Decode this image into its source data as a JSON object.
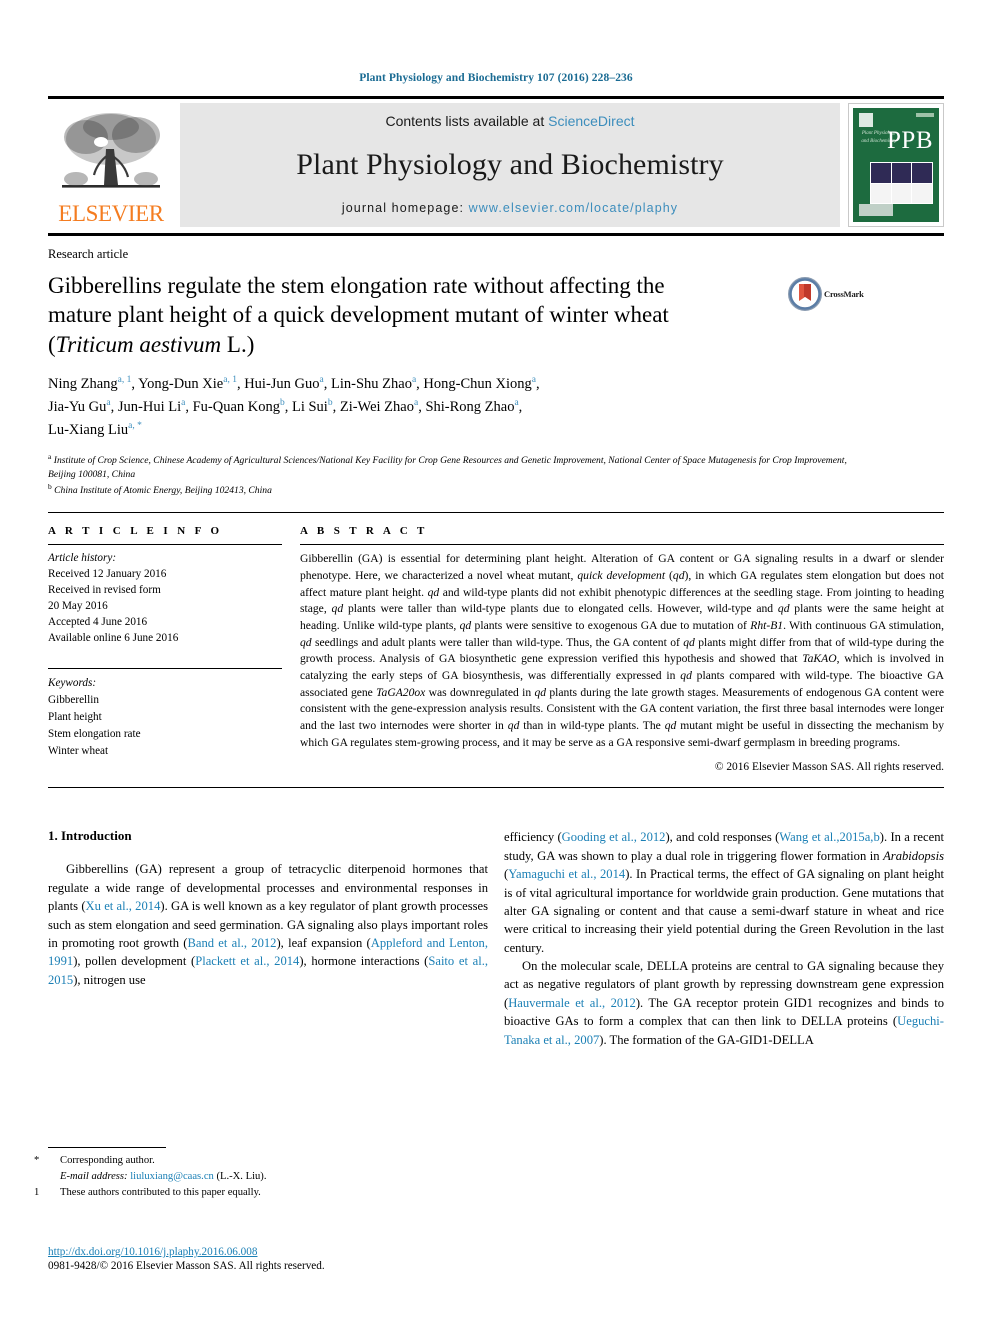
{
  "running_head": "Plant Physiology and Biochemistry 107 (2016) 228–236",
  "masthead": {
    "contents_prefix": "Contents lists available at ",
    "sciencedirect": "ScienceDirect",
    "journal_title": "Plant Physiology and Biochemistry",
    "homepage_label": "journal homepage:",
    "homepage_url": "www.elsevier.com/locate/plaphy",
    "publisher": "ELSEVIER",
    "cover_acronym": "PPB",
    "cover_journal_name": "Plant Physiology and Biochemistry",
    "link_color": "#3c8dbc",
    "cover_color": "#1d6b3f",
    "publisher_color": "#F47C20"
  },
  "article": {
    "category": "Research article",
    "title_line1": "Gibberellins regulate the stem elongation rate without affecting the",
    "title_line2": "mature plant height of a quick development mutant of winter wheat",
    "title_line3_prefix": "(",
    "title_line3_italic": "Triticum aestivum",
    "title_line3_suffix": " L.)",
    "crossmark_label": "CrossMark",
    "authors_line1": "Ning Zhang a, 1, Yong-Dun Xie a, 1, Hui-Jun Guo a, Lin-Shu Zhao a, Hong-Chun Xiong a,",
    "authors_line2": "Jia-Yu Gu a, Jun-Hui Li a, Fu-Quan Kong b, Li Sui b, Zi-Wei Zhao a, Shi-Rong Zhao a,",
    "authors_line3": "Lu-Xiang Liu a, *",
    "affiliation_a": "Institute of Crop Science, Chinese Academy of Agricultural Sciences/National Key Facility for Crop Gene Resources and Genetic Improvement, National Center of Space Mutagenesis for Crop Improvement, Beijing 100081, China",
    "affiliation_b": "China Institute of Atomic Energy, Beijing 102413, China"
  },
  "article_info": {
    "heading": "A R T I C L E  I N F O",
    "history_label": "Article history:",
    "received": "Received 12 January 2016",
    "revised_label": "Received in revised form",
    "revised_date": "20 May 2016",
    "accepted": "Accepted 4 June 2016",
    "available": "Available online 6 June 2016",
    "keywords_label": "Keywords:",
    "keywords": [
      "Gibberellin",
      "Plant height",
      "Stem elongation rate",
      "Winter wheat"
    ]
  },
  "abstract": {
    "heading": "A B S T R A C T",
    "body_part1": "Gibberellin (GA) is essential for determining plant height. Alteration of GA content or GA signaling results in a dwarf or slender phenotype. Here, we characterized a novel wheat mutant, ",
    "mutant_name_italic": "quick development",
    "body_part2": " (",
    "qd_1": "qd",
    "body_part3": "), in which GA regulates stem elongation but does not affect mature plant height. ",
    "qd_2": "qd",
    "body_part4": " and wild-type plants did not exhibit phenotypic differences at the seedling stage. From jointing to heading stage, ",
    "qd_3": "qd",
    "body_part5": " plants were taller than wild-type plants due to elongated cells. However, wild-type and ",
    "qd_4": "qd",
    "body_part6": " plants were the same height at heading. Unlike wild-type plants, ",
    "qd_5": "qd",
    "body_part7": " plants were sensitive to exogenous GA due to mutation of ",
    "rht_italic": "Rht-B1",
    "body_part8": ". With continuous GA stimulation, ",
    "qd_6": "qd",
    "body_part9": " seedlings and adult plants were taller than wild-type. Thus, the GA content of ",
    "qd_7": "qd",
    "body_part10": " plants might differ from that of wild-type during the growth process. Analysis of GA biosynthetic gene expression verified this hypothesis and showed that ",
    "takao_italic": "TaKAO",
    "body_part11": ", which is involved in catalyzing the early steps of GA biosynthesis, was differentially expressed in ",
    "qd_8": "qd",
    "body_part12": " plants compared with wild-type. The bioactive GA associated gene ",
    "taga20ox_italic": "TaGA20ox",
    "body_part13": " was downregulated in ",
    "qd_9": "qd",
    "body_part14": " plants during the late growth stages. Measurements of endogenous GA content were consistent with the gene-expression analysis results. Consistent with the GA content variation, the first three basal internodes were longer and the last two internodes were shorter in ",
    "qd_10": "qd",
    "body_part15": " than in wild-type plants. The ",
    "qd_11": "qd",
    "body_part16": " mutant might be useful in dissecting the mechanism by which GA regulates stem-growing process, and it may be serve as a GA responsive semi-dwarf germplasm in breeding programs.",
    "copyright": "© 2016 Elsevier Masson SAS. All rights reserved."
  },
  "introduction": {
    "section_number": "1.",
    "section_title": "Introduction",
    "left_p1_a": "Gibberellins (GA) represent a group of tetracyclic diterpenoid hormones that regulate a wide range of developmental processes and environmental responses in plants (",
    "ref_xu": "Xu et al., 2014",
    "left_p1_b": "). GA is well known as a key regulator of plant growth processes such as stem elongation and seed germination. GA signaling also plays important roles in promoting root growth (",
    "ref_band": "Band et al., 2012",
    "left_p1_c": "), leaf expansion (",
    "ref_appleford": "Appleford and Lenton, 1991",
    "left_p1_d": "), pollen development (",
    "ref_plackett": "Plackett et al., 2014",
    "left_p1_e": "), hormone interactions (",
    "ref_saito": "Saito et al., 2015",
    "left_p1_f": "), nitrogen use ",
    "right_p1_a": "efficiency (",
    "ref_gooding": "Gooding et al., 2012",
    "right_p1_b": "), and cold responses (",
    "ref_wang": "Wang et al.,2015a,b",
    "right_p1_c": "). In a recent study, GA was shown to play a dual role in triggering flower formation in ",
    "arabidopsis_italic": "Arabidopsis",
    "right_p1_d": " (",
    "ref_yamaguchi": "Yamaguchi et al., 2014",
    "right_p1_e": "). In Practical terms, the effect of GA signaling on plant height is of vital agricultural importance for worldwide grain production. Gene mutations that alter GA signaling or content and that cause a semi-dwarf stature in wheat and rice were critical to increasing their yield potential during the Green Revolution in the last century.",
    "right_p2_a": "On the molecular scale, DELLA proteins are central to GA signaling because they act as negative regulators of plant growth by repressing downstream gene expression (",
    "ref_hauvermale": "Hauvermale et al., 2012",
    "right_p2_b": "). The GA receptor protein GID1 recognizes and binds to bioactive GAs to form a complex that can then link to DELLA proteins (",
    "ref_ueguchi": "Ueguchi-Tanaka et al., 2007",
    "right_p2_c": "). The formation of the GA-GID1-DELLA"
  },
  "footnotes": {
    "corresponding_mark": "*",
    "corresponding_text": "Corresponding author.",
    "email_label": "E-mail address:",
    "email": "liuluxiang@caas.cn",
    "email_suffix": " (L.-X. Liu).",
    "equal_mark": "1",
    "equal_text": "These authors contributed to this paper equally.",
    "doi": "http://dx.doi.org/10.1016/j.plaphy.2016.06.008",
    "issn": "0981-9428/© 2016 Elsevier Masson SAS. All rights reserved.",
    "link_color": "#1a7fb5"
  }
}
